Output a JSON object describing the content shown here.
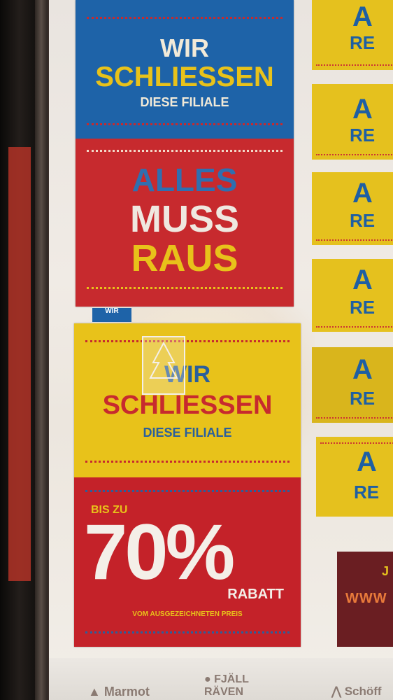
{
  "poster_top": {
    "line1": "WIR",
    "line2": "SCHLIESSEN",
    "line3": "DIESE FILIALE",
    "line4": "ALLES",
    "line5": "MUSS",
    "line6": "RAUS"
  },
  "poster_bottom": {
    "line1": "WIR",
    "line2": "SCHLIESSEN",
    "line3": "DIESE FILIALE",
    "discount_prefix": "BIS ZU",
    "discount_value": "70%",
    "discount_label": "RABATT",
    "discount_note": "VOM AUSGEZEICHNETEN PREIS"
  },
  "tag_label": "WIR",
  "side_posters": [
    {
      "l1": "A",
      "l2": "RE"
    },
    {
      "l1": "A",
      "l2": "RE"
    },
    {
      "l1": "A",
      "l2": "RE"
    },
    {
      "l1": "A",
      "l2": "RE"
    },
    {
      "l1": "A",
      "l2": "RE"
    },
    {
      "l1": "A",
      "l2": "RE"
    }
  ],
  "dark_box": {
    "l1": "J",
    "l2": "WWW"
  },
  "brands": {
    "b1": "Marmot",
    "b2": "FJÄLL RÄVEN",
    "b3": "Schöff"
  },
  "colors": {
    "blue": "#1e63a8",
    "red": "#c72a2e",
    "yellow": "#e8c21a",
    "light_blue": "#4aa3e0"
  }
}
